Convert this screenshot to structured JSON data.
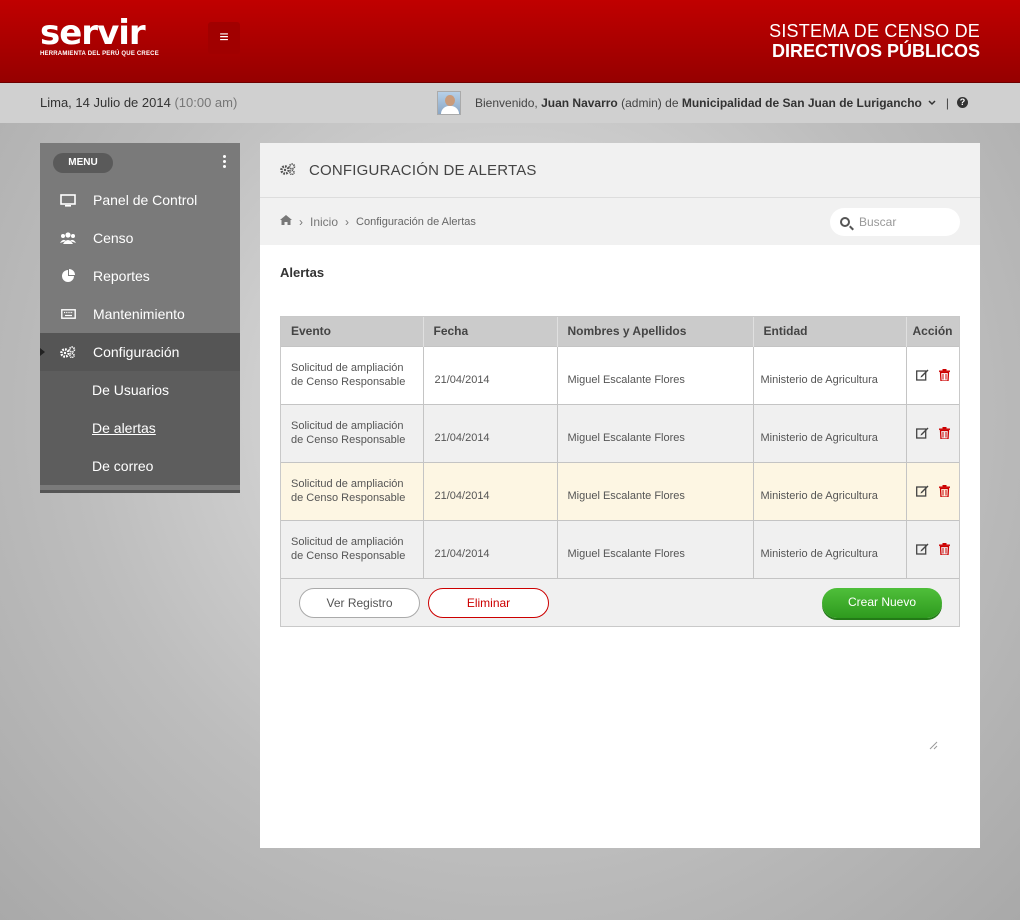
{
  "header": {
    "logo_word": "servir",
    "logo_tagline": "HERRAMIENTA DEL PERÚ QUE CRECE",
    "system_line1": "SISTEMA DE CENSO  DE",
    "system_line2": "DIRECTIVOS PÚBLICOS",
    "menu_icon": "hamburger-icon"
  },
  "infobar": {
    "date": "Lima, 14 Julio de 2014",
    "time": "(10:00 am)",
    "welcome": "Bienvenido,",
    "user_name": "Juan Navarro",
    "user_role": "(admin)",
    "of": "de",
    "entity": "Municipalidad de San Juan de Lurigancho",
    "help_icon": "help-icon"
  },
  "sidebar": {
    "menu_label": "MENU",
    "items": [
      {
        "label": "Panel de Control",
        "icon": "monitor-icon"
      },
      {
        "label": "Censo",
        "icon": "users-icon"
      },
      {
        "label": "Reportes",
        "icon": "pie-chart-icon"
      },
      {
        "label": "Mantenimiento",
        "icon": "keyboard-icon"
      },
      {
        "label": "Configuración",
        "icon": "gears-icon"
      }
    ],
    "subitems": [
      {
        "label": "De Usuarios"
      },
      {
        "label": "De alertas"
      },
      {
        "label": "De correo"
      }
    ]
  },
  "main": {
    "title": "CONFIGURACIÓN DE ALERTAS",
    "breadcrumb": {
      "home": "Inicio",
      "current": "Configuración de Alertas"
    },
    "search_placeholder": "Buscar",
    "section": "Alertas",
    "table": {
      "headers": [
        "Evento",
        "Fecha",
        "Nombres y Apellidos",
        "Entidad",
        "Acción"
      ],
      "rows": [
        {
          "event_line1": "Solicitud de ampliación",
          "event_line2": "de Censo Responsable",
          "date": "21/04/2014",
          "name": "Miguel Escalante Flores",
          "entity": "Ministerio de Agricultura"
        },
        {
          "event_line1": "Solicitud de ampliación",
          "event_line2": "de Censo Responsable",
          "date": "21/04/2014",
          "name": "Miguel Escalante Flores",
          "entity": "Ministerio de Agricultura"
        },
        {
          "event_line1": "Solicitud de ampliación",
          "event_line2": "de Censo Responsable",
          "date": "21/04/2014",
          "name": "Miguel Escalante Flores",
          "entity": "Ministerio de Agricultura"
        },
        {
          "event_line1": "Solicitud de ampliación",
          "event_line2": "de Censo Responsable",
          "date": "21/04/2014",
          "name": "Miguel Escalante Flores",
          "entity": "Ministerio de Agricultura"
        }
      ]
    },
    "buttons": {
      "view": "Ver Registro",
      "delete": "Eliminar",
      "create": "Crear Nuevo"
    }
  },
  "colors": {
    "brand_red": "#b30000",
    "success_green": "#3aa82a",
    "danger_red": "#cc0000",
    "row_highlight": "#fdf6e3"
  }
}
